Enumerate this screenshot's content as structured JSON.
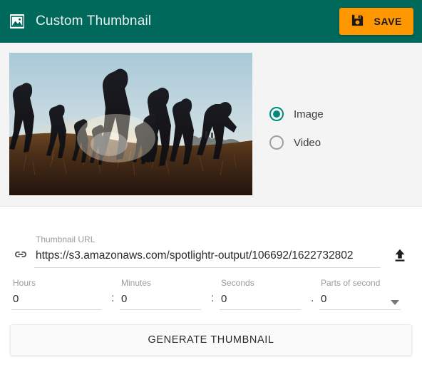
{
  "header": {
    "title": "Custom Thumbnail",
    "icon": "image-icon",
    "save_label": "SAVE",
    "save_icon": "save-floppy-icon",
    "background_color": "#00695C",
    "save_color": "#FF9800"
  },
  "preview": {
    "alt": "Silhouetted runners on a grassy hill at sunset",
    "sky_color": "#9fc4d4",
    "sun_color": "#fff3d8",
    "field_color": "#3a2418"
  },
  "media_type": {
    "selected": "Image",
    "options": [
      {
        "label": "Image",
        "selected": true
      },
      {
        "label": "Video",
        "selected": false
      }
    ],
    "accent_color": "#00897B"
  },
  "url_field": {
    "icon": "link-icon",
    "label": "Thumbnail URL",
    "value": "https://s3.amazonaws.com/spotlightr-output/106692/1622732802",
    "placeholder": "Thumbnail URL",
    "upload_icon": "upload-icon"
  },
  "time_fields": [
    {
      "label": "Hours",
      "value": "0",
      "separator": ""
    },
    {
      "label": "Minutes",
      "value": "0",
      "separator": ":"
    },
    {
      "label": "Seconds",
      "value": "0",
      "separator": ":"
    },
    {
      "label": "Parts of second",
      "value": "0",
      "separator": ".",
      "caret": "chevron-down-icon"
    }
  ],
  "actions": {
    "generate_label": "GENERATE THUMBNAIL"
  }
}
